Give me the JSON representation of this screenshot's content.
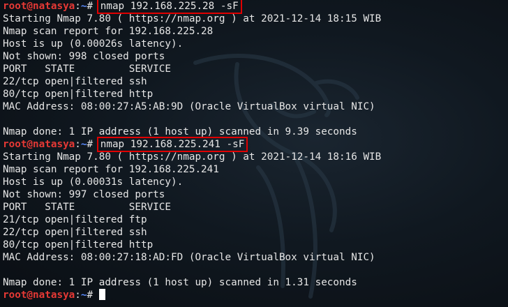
{
  "prompt": {
    "user_host": "root@natasya",
    "separator": ":",
    "path": "~",
    "symbol": "# "
  },
  "session1": {
    "command": "nmap 192.168.225.28 -sF",
    "output": [
      "Starting Nmap 7.80 ( https://nmap.org ) at 2021-12-14 18:15 WIB",
      "Nmap scan report for 192.168.225.28",
      "Host is up (0.00026s latency).",
      "Not shown: 998 closed ports",
      "PORT   STATE         SERVICE",
      "22/tcp open|filtered ssh",
      "80/tcp open|filtered http",
      "MAC Address: 08:00:27:A5:AB:9D (Oracle VirtualBox virtual NIC)",
      "",
      "Nmap done: 1 IP address (1 host up) scanned in 9.39 seconds"
    ]
  },
  "session2": {
    "command": "nmap 192.168.225.241 -sF",
    "output": [
      "Starting Nmap 7.80 ( https://nmap.org ) at 2021-12-14 18:16 WIB",
      "Nmap scan report for 192.168.225.241",
      "Host is up (0.00031s latency).",
      "Not shown: 997 closed ports",
      "PORT   STATE         SERVICE",
      "21/tcp open|filtered ftp",
      "22/tcp open|filtered ssh",
      "80/tcp open|filtered http",
      "MAC Address: 08:00:27:18:AD:FD (Oracle VirtualBox virtual NIC)",
      "",
      "Nmap done: 1 IP address (1 host up) scanned in 1.31 seconds"
    ]
  }
}
